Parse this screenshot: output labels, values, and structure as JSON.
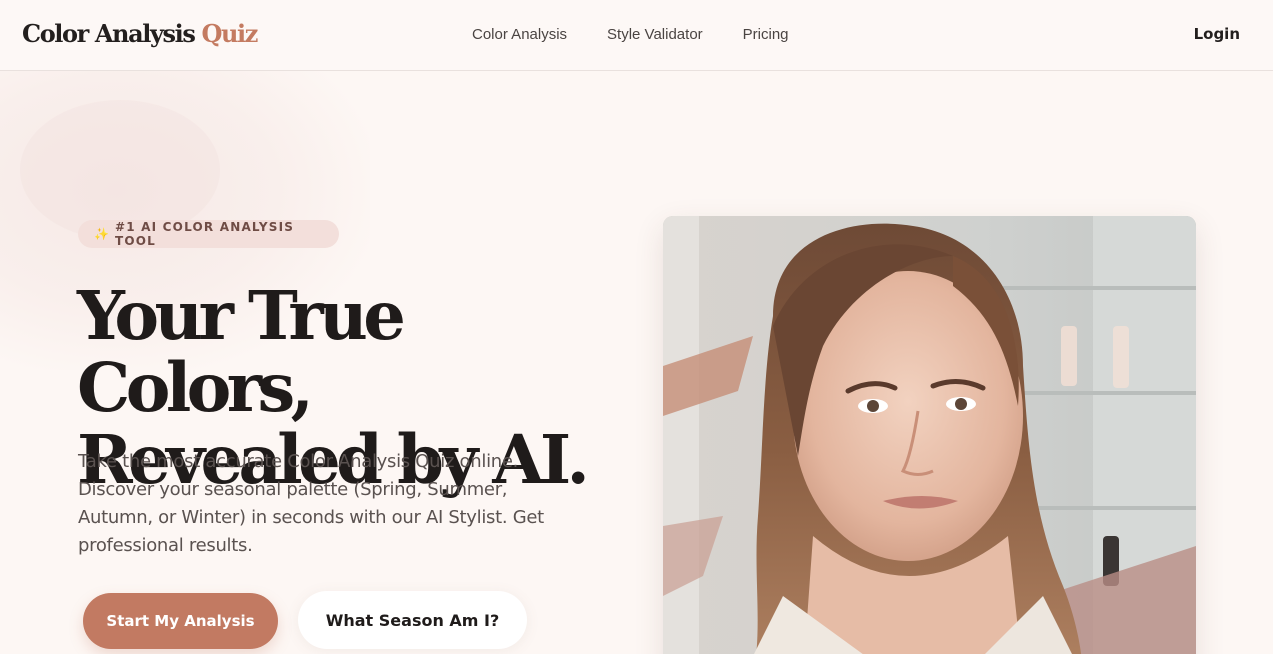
{
  "header": {
    "logo_main": "Color Analysis",
    "logo_accent": "Quiz",
    "nav": [
      {
        "label": "Color Analysis"
      },
      {
        "label": "Style Validator"
      },
      {
        "label": "Pricing"
      }
    ],
    "login_label": "Login"
  },
  "hero": {
    "badge_icon": "sparkles-icon",
    "badge_text": "#1 AI COLOR ANALYSIS TOOL",
    "title_line1": "Your True Colors,",
    "title_line2": "Revealed by AI.",
    "description": "Take the most accurate Color Analysis Quiz online. Discover your seasonal palette (Spring, Summer, Autumn, or Winter) in seconds with our AI Stylist. Get professional results.",
    "primary_button": "Start My Analysis",
    "secondary_button": "What Season Am I?",
    "image_alt": "Woman portrait"
  },
  "colors": {
    "accent": "#c47b61",
    "button_primary": "#c27a62",
    "background": "#fdf7f4",
    "badge_bg": "#f3dfdb"
  }
}
